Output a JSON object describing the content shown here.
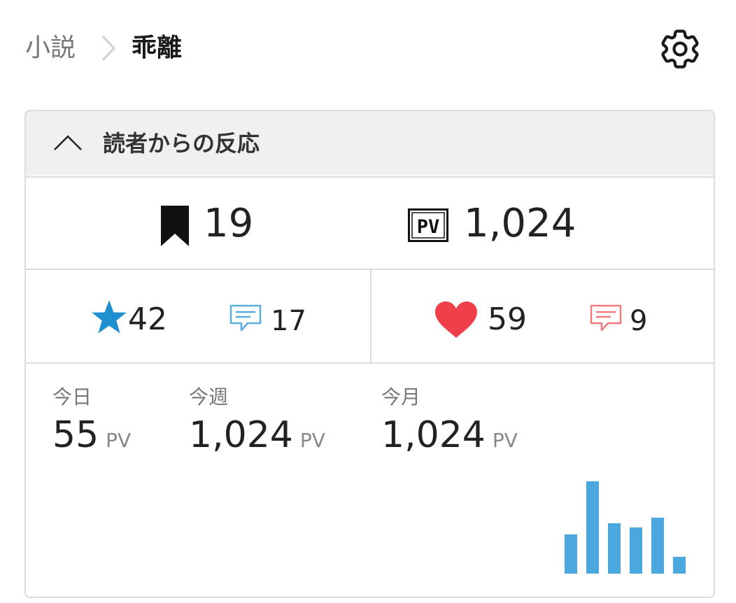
{
  "breadcrumb": {
    "parent": "小説",
    "current": "乖離"
  },
  "icons": {
    "settings": "gear-icon",
    "collapse": "chevron-up-icon",
    "bookmark": "bookmark-icon",
    "page_views": "pv-icon",
    "star": "star-icon",
    "comment": "comment-icon",
    "heart": "heart-icon"
  },
  "panel": {
    "title": "読者からの反応"
  },
  "summary": {
    "bookmarks": "19",
    "page_views": "1,024"
  },
  "reactions": {
    "stars": "42",
    "star_comments": "17",
    "hearts": "59",
    "heart_comments": "9"
  },
  "stats": {
    "today": {
      "label": "今日",
      "value": "55",
      "unit": "PV"
    },
    "week": {
      "label": "今週",
      "value": "1,024",
      "unit": "PV"
    },
    "month": {
      "label": "今月",
      "value": "1,024",
      "unit": "PV"
    }
  },
  "colors": {
    "star": "#1e90d0",
    "comment_blue": "#5aaede",
    "heart": "#ee3f4b",
    "comment_red": "#f07b7e",
    "bars": "#4aa8de"
  },
  "chart_data": {
    "type": "bar",
    "values": [
      28,
      66,
      36,
      33,
      40,
      12
    ],
    "ylim": [
      0,
      70
    ],
    "grid": false
  }
}
